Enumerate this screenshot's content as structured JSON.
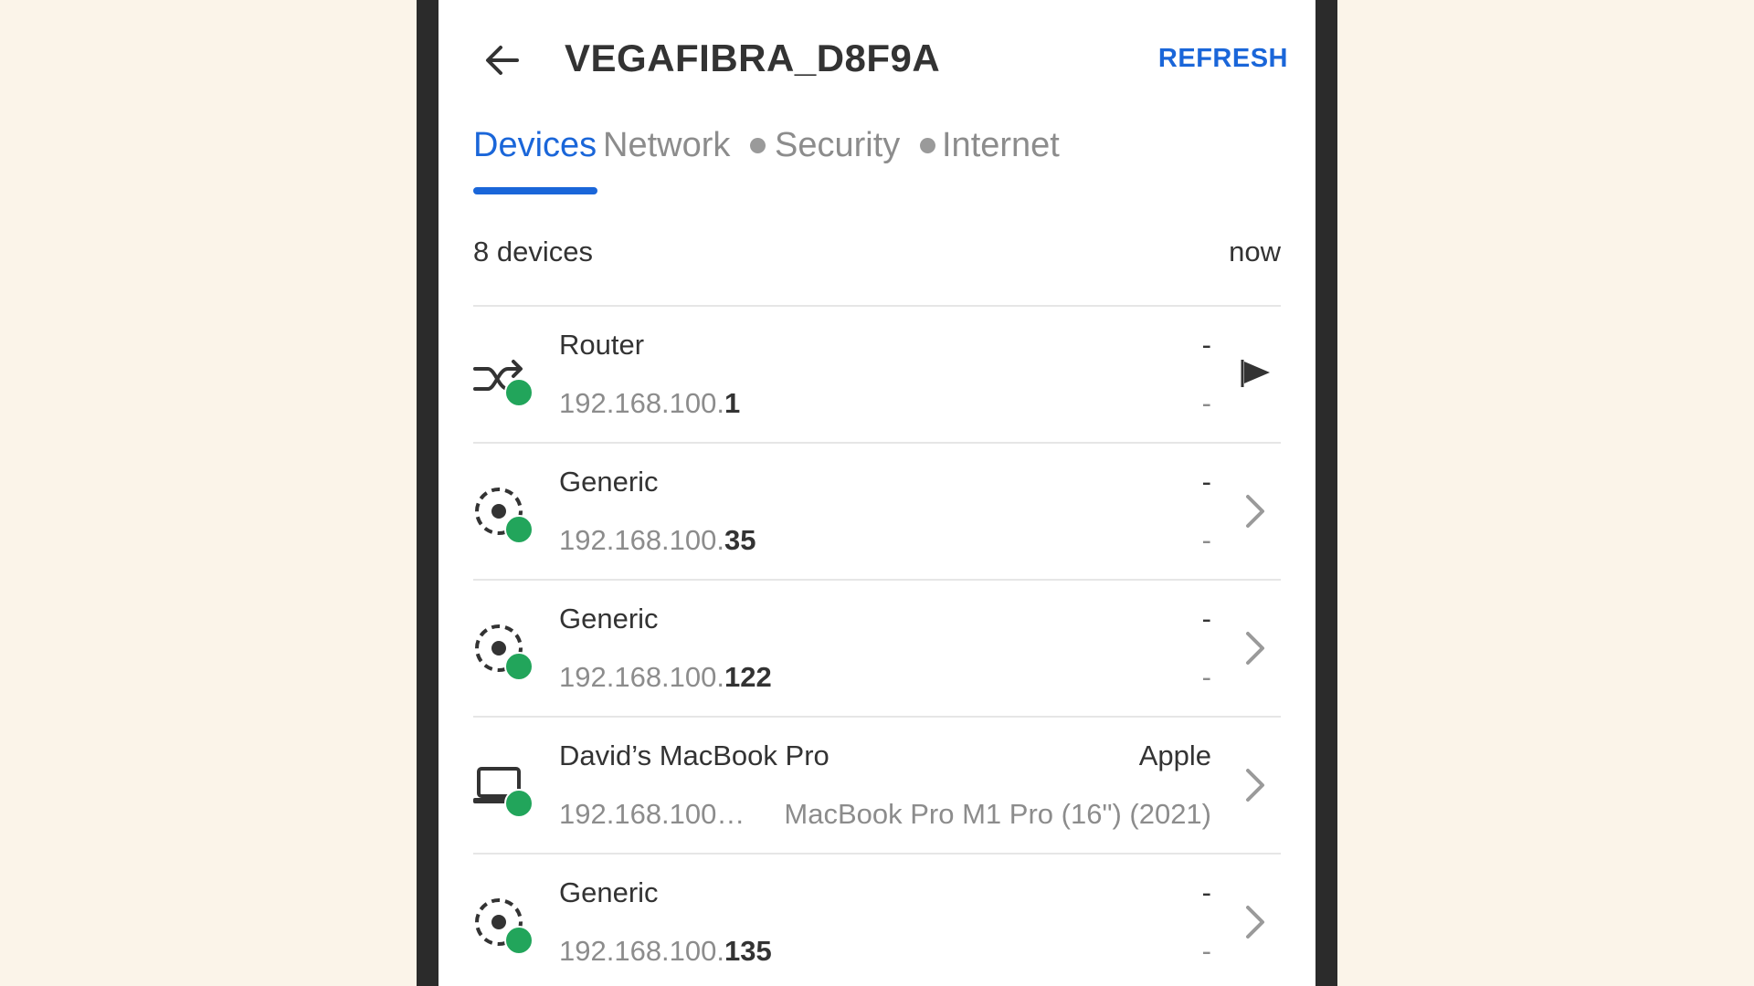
{
  "header": {
    "back_icon": "arrow-left-icon",
    "title": "VEGAFIBRA_D8F9A",
    "refresh_label": "REFRESH"
  },
  "tabs": [
    {
      "label": "Devices",
      "active": true,
      "has_dot": false
    },
    {
      "label": "Network",
      "active": false,
      "has_dot": true
    },
    {
      "label": "Security",
      "active": false,
      "has_dot": true
    },
    {
      "label": "Internet",
      "active": false,
      "has_dot": false
    }
  ],
  "summary": {
    "count": "8 devices",
    "updated": "now"
  },
  "devices": [
    {
      "name": "Router",
      "ip_prefix": "192.168.100.",
      "ip_suffix": "1",
      "vendor": "-",
      "model": "-",
      "icon": "router-icon",
      "action_icon": "flag-icon",
      "online": true
    },
    {
      "name": "Generic",
      "ip_prefix": "192.168.100.",
      "ip_suffix": "35",
      "vendor": "-",
      "model": "-",
      "icon": "generic-device-icon",
      "action_icon": "chevron-right-icon",
      "online": true
    },
    {
      "name": "Generic",
      "ip_prefix": "192.168.100.",
      "ip_suffix": "122",
      "vendor": "-",
      "model": "-",
      "icon": "generic-device-icon",
      "action_icon": "chevron-right-icon",
      "online": true
    },
    {
      "name": "David’s MacBook Pro",
      "ip_prefix": "192.168.100…",
      "ip_suffix": "",
      "vendor": "Apple",
      "model": "MacBook Pro M1 Pro (16\") (2021)",
      "icon": "laptop-icon",
      "action_icon": "chevron-right-icon",
      "online": true
    },
    {
      "name": "Generic",
      "ip_prefix": "192.168.100.",
      "ip_suffix": "135",
      "vendor": "-",
      "model": "-",
      "icon": "generic-device-icon",
      "action_icon": "chevron-right-icon",
      "online": true
    }
  ],
  "colors": {
    "accent": "#1a66d9",
    "online": "#22a55b",
    "background": "#fbf4e9",
    "bezel": "#2b2b2b"
  }
}
